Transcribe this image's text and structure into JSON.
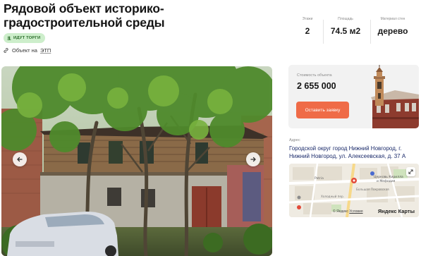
{
  "header": {
    "title": "Рядовой объект историко-градостроительной среды",
    "badge": "ИДУТ ТОРГИ",
    "etp_prefix": "Объект на",
    "etp_link": "ЭТП"
  },
  "stats": [
    {
      "label": "Этажи",
      "value": "2"
    },
    {
      "label": "Площадь",
      "value": "74.5 м2"
    },
    {
      "label": "Материал стен",
      "value": "дерево"
    }
  ],
  "price_card": {
    "label": "Стоимость объекта",
    "price": "2 655 000",
    "button": "Оставить заявку"
  },
  "address": {
    "label": "Адрес",
    "text": "Городской округ город Нижний Новгород, г. Нижний Новгород, ул. Алексеевская, д. 37 А"
  },
  "map": {
    "logo": "Яндекс Карты",
    "legal_prefix": "© Яндекс",
    "legal_link": "Условия",
    "labels": [
      "Patria",
      "Церковь Кирилла и Мефодия",
      "Большая Покровская улица",
      "Холодный пер.",
      "ул. Алексеевская"
    ]
  },
  "colors": {
    "accent": "#ef6b47",
    "badge_bg": "#cdeecb",
    "badge_text": "#2a6b2a",
    "card_bg": "#f2f2f2"
  }
}
